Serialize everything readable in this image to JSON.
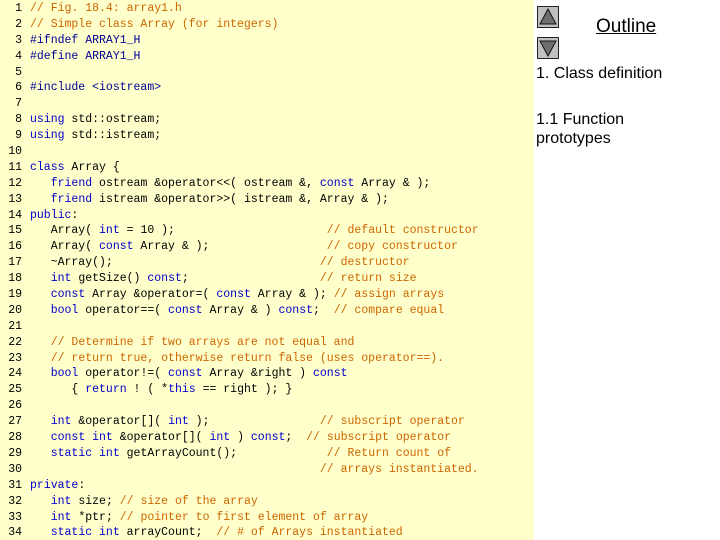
{
  "code": {
    "lines": [
      [
        {
          "t": "c",
          "v": "// Fig. 18.4: array1.h"
        }
      ],
      [
        {
          "t": "c",
          "v": "// Simple class Array (for integers)"
        }
      ],
      [
        {
          "t": "p",
          "v": "#ifndef ARRAY1_H"
        }
      ],
      [
        {
          "t": "p",
          "v": "#define ARRAY1_H"
        }
      ],
      [],
      [
        {
          "t": "p",
          "v": "#include <iostream>"
        }
      ],
      [],
      [
        {
          "t": "k",
          "v": "using"
        },
        {
          "t": "t",
          "v": " std::ostream;"
        }
      ],
      [
        {
          "t": "k",
          "v": "using"
        },
        {
          "t": "t",
          "v": " std::istream;"
        }
      ],
      [],
      [
        {
          "t": "k",
          "v": "class"
        },
        {
          "t": "t",
          "v": " Array {"
        }
      ],
      [
        {
          "t": "t",
          "v": "   "
        },
        {
          "t": "k",
          "v": "friend"
        },
        {
          "t": "t",
          "v": " ostream &operator<<( ostream &, "
        },
        {
          "t": "k",
          "v": "const"
        },
        {
          "t": "t",
          "v": " Array & );"
        }
      ],
      [
        {
          "t": "t",
          "v": "   "
        },
        {
          "t": "k",
          "v": "friend"
        },
        {
          "t": "t",
          "v": " istream &operator>>( istream &, Array & );"
        }
      ],
      [
        {
          "t": "k",
          "v": "public"
        },
        {
          "t": "t",
          "v": ":"
        }
      ],
      [
        {
          "t": "t",
          "v": "   Array( "
        },
        {
          "t": "k",
          "v": "int"
        },
        {
          "t": "t",
          "v": " = 10 );                      "
        },
        {
          "t": "c",
          "v": "// default constructor"
        }
      ],
      [
        {
          "t": "t",
          "v": "   Array( "
        },
        {
          "t": "k",
          "v": "const"
        },
        {
          "t": "t",
          "v": " Array & );                 "
        },
        {
          "t": "c",
          "v": "// copy constructor"
        }
      ],
      [
        {
          "t": "t",
          "v": "   ~Array();                              "
        },
        {
          "t": "c",
          "v": "// destructor"
        }
      ],
      [
        {
          "t": "t",
          "v": "   "
        },
        {
          "t": "k",
          "v": "int"
        },
        {
          "t": "t",
          "v": " getSize() "
        },
        {
          "t": "k",
          "v": "const"
        },
        {
          "t": "t",
          "v": ";                   "
        },
        {
          "t": "c",
          "v": "// return size"
        }
      ],
      [
        {
          "t": "t",
          "v": "   "
        },
        {
          "t": "k",
          "v": "const"
        },
        {
          "t": "t",
          "v": " Array &operator=( "
        },
        {
          "t": "k",
          "v": "const"
        },
        {
          "t": "t",
          "v": " Array & ); "
        },
        {
          "t": "c",
          "v": "// assign arrays"
        }
      ],
      [
        {
          "t": "t",
          "v": "   "
        },
        {
          "t": "k",
          "v": "bool"
        },
        {
          "t": "t",
          "v": " operator==( "
        },
        {
          "t": "k",
          "v": "const"
        },
        {
          "t": "t",
          "v": " Array & ) "
        },
        {
          "t": "k",
          "v": "const"
        },
        {
          "t": "t",
          "v": ";  "
        },
        {
          "t": "c",
          "v": "// compare equal"
        }
      ],
      [],
      [
        {
          "t": "t",
          "v": "   "
        },
        {
          "t": "c",
          "v": "// Determine if two arrays are not equal and"
        }
      ],
      [
        {
          "t": "t",
          "v": "   "
        },
        {
          "t": "c",
          "v": "// return true, otherwise return false (uses operator==)."
        }
      ],
      [
        {
          "t": "t",
          "v": "   "
        },
        {
          "t": "k",
          "v": "bool"
        },
        {
          "t": "t",
          "v": " operator!=( "
        },
        {
          "t": "k",
          "v": "const"
        },
        {
          "t": "t",
          "v": " Array &right ) "
        },
        {
          "t": "k",
          "v": "const"
        }
      ],
      [
        {
          "t": "t",
          "v": "      { "
        },
        {
          "t": "k",
          "v": "return"
        },
        {
          "t": "t",
          "v": " ! ( *"
        },
        {
          "t": "k",
          "v": "this"
        },
        {
          "t": "t",
          "v": " == right ); }"
        }
      ],
      [],
      [
        {
          "t": "t",
          "v": "   "
        },
        {
          "t": "k",
          "v": "int"
        },
        {
          "t": "t",
          "v": " &operator[]( "
        },
        {
          "t": "k",
          "v": "int"
        },
        {
          "t": "t",
          "v": " );                "
        },
        {
          "t": "c",
          "v": "// subscript operator"
        }
      ],
      [
        {
          "t": "t",
          "v": "   "
        },
        {
          "t": "k",
          "v": "const int"
        },
        {
          "t": "t",
          "v": " &operator[]( "
        },
        {
          "t": "k",
          "v": "int"
        },
        {
          "t": "t",
          "v": " ) "
        },
        {
          "t": "k",
          "v": "const"
        },
        {
          "t": "t",
          "v": ";  "
        },
        {
          "t": "c",
          "v": "// subscript operator"
        }
      ],
      [
        {
          "t": "t",
          "v": "   "
        },
        {
          "t": "k",
          "v": "static int"
        },
        {
          "t": "t",
          "v": " getArrayCount();             "
        },
        {
          "t": "c",
          "v": "// Return count of"
        }
      ],
      [
        {
          "t": "t",
          "v": "                                          "
        },
        {
          "t": "c",
          "v": "// arrays instantiated."
        }
      ],
      [
        {
          "t": "k",
          "v": "private"
        },
        {
          "t": "t",
          "v": ":"
        }
      ],
      [
        {
          "t": "t",
          "v": "   "
        },
        {
          "t": "k",
          "v": "int"
        },
        {
          "t": "t",
          "v": " size; "
        },
        {
          "t": "c",
          "v": "// size of the array"
        }
      ],
      [
        {
          "t": "t",
          "v": "   "
        },
        {
          "t": "k",
          "v": "int"
        },
        {
          "t": "t",
          "v": " *ptr; "
        },
        {
          "t": "c",
          "v": "// pointer to first element of array"
        }
      ],
      [
        {
          "t": "t",
          "v": "   "
        },
        {
          "t": "k",
          "v": "static int"
        },
        {
          "t": "t",
          "v": " arrayCount;  "
        },
        {
          "t": "c",
          "v": "// # of Arrays instantiated"
        }
      ]
    ]
  },
  "outline": {
    "title": "Outline",
    "items": [
      "1. Class definition",
      "1.1 Function prototypes"
    ]
  },
  "nav": {
    "up_icon": "triangle-up-icon",
    "down_icon": "triangle-down-icon"
  },
  "colors": {
    "code_background": "#ffffcc",
    "comment": "#cc6600",
    "keyword": "#0000cc",
    "preprocessor": "#000099",
    "text": "#000000"
  }
}
